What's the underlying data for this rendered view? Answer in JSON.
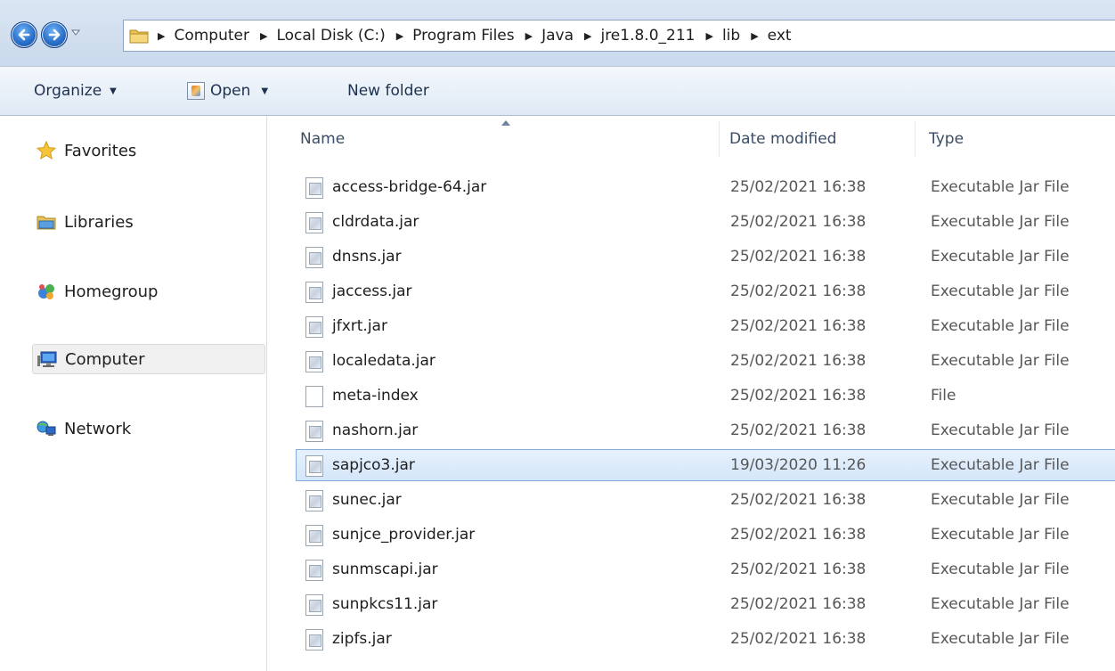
{
  "address_bar": {
    "crumbs": [
      "Computer",
      "Local Disk (C:)",
      "Program Files",
      "Java",
      "jre1.8.0_211",
      "lib",
      "ext"
    ]
  },
  "toolbar": {
    "organize_label": "Organize",
    "open_label": "Open",
    "new_folder_label": "New folder"
  },
  "sidebar": {
    "items": [
      {
        "label": "Favorites",
        "icon": "star-icon"
      },
      {
        "label": "Libraries",
        "icon": "libraries-icon"
      },
      {
        "label": "Homegroup",
        "icon": "homegroup-icon"
      },
      {
        "label": "Computer",
        "icon": "computer-icon",
        "selected": true
      },
      {
        "label": "Network",
        "icon": "network-icon"
      }
    ]
  },
  "columns": {
    "name": "Name",
    "date": "Date modified",
    "type": "Type"
  },
  "files": [
    {
      "name": "access-bridge-64.jar",
      "date": "25/02/2021 16:38",
      "type": "Executable Jar File",
      "icon": "jar-file-icon"
    },
    {
      "name": "cldrdata.jar",
      "date": "25/02/2021 16:38",
      "type": "Executable Jar File",
      "icon": "jar-file-icon"
    },
    {
      "name": "dnsns.jar",
      "date": "25/02/2021 16:38",
      "type": "Executable Jar File",
      "icon": "jar-file-icon"
    },
    {
      "name": "jaccess.jar",
      "date": "25/02/2021 16:38",
      "type": "Executable Jar File",
      "icon": "jar-file-icon"
    },
    {
      "name": "jfxrt.jar",
      "date": "25/02/2021 16:38",
      "type": "Executable Jar File",
      "icon": "jar-file-icon"
    },
    {
      "name": "localedata.jar",
      "date": "25/02/2021 16:38",
      "type": "Executable Jar File",
      "icon": "jar-file-icon"
    },
    {
      "name": "meta-index",
      "date": "25/02/2021 16:38",
      "type": "File",
      "icon": "blank-file-icon"
    },
    {
      "name": "nashorn.jar",
      "date": "25/02/2021 16:38",
      "type": "Executable Jar File",
      "icon": "jar-file-icon"
    },
    {
      "name": "sapjco3.jar",
      "date": "19/03/2020 11:26",
      "type": "Executable Jar File",
      "icon": "jar-file-icon",
      "selected": true
    },
    {
      "name": "sunec.jar",
      "date": "25/02/2021 16:38",
      "type": "Executable Jar File",
      "icon": "jar-file-icon"
    },
    {
      "name": "sunjce_provider.jar",
      "date": "25/02/2021 16:38",
      "type": "Executable Jar File",
      "icon": "jar-file-icon"
    },
    {
      "name": "sunmscapi.jar",
      "date": "25/02/2021 16:38",
      "type": "Executable Jar File",
      "icon": "jar-file-icon"
    },
    {
      "name": "sunpkcs11.jar",
      "date": "25/02/2021 16:38",
      "type": "Executable Jar File",
      "icon": "jar-file-icon"
    },
    {
      "name": "zipfs.jar",
      "date": "25/02/2021 16:38",
      "type": "Executable Jar File",
      "icon": "jar-file-icon"
    }
  ],
  "colors": {
    "selection_fill": "#d9e8fb",
    "selection_border": "#84acdd",
    "address_bg": "#d4e1f0"
  }
}
